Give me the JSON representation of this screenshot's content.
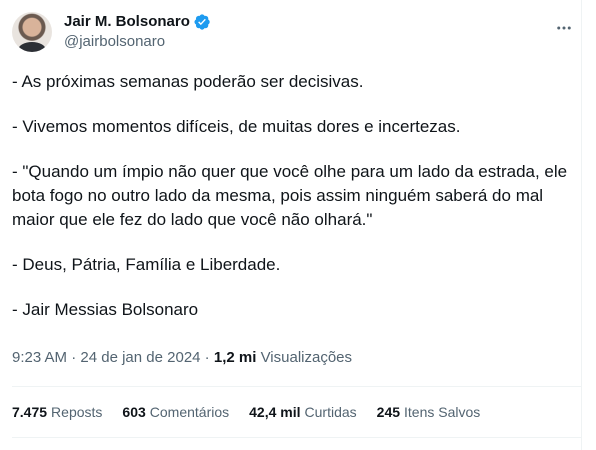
{
  "author": {
    "display_name": "Jair M. Bolsonaro",
    "handle": "@jairbolsonaro",
    "verified": true,
    "avatar_icon": "profile-photo"
  },
  "more_icon": "ellipsis-icon",
  "tweet": {
    "paragraphs": [
      "- As próximas semanas poderão ser decisivas.",
      "- Vivemos momentos difíceis, de muitas dores e incertezas.",
      "- \"Quando um ímpio não quer que você olhe para um lado da estrada, ele bota fogo no outro lado da mesma, pois assim ninguém saberá do mal maior que ele fez do lado que você não olhará.\"",
      "- Deus, Pátria, Família e Liberdade.",
      "- Jair Messias Bolsonaro"
    ]
  },
  "meta": {
    "time": "9:23 AM",
    "separator": " · ",
    "date": "24 de jan de 2024",
    "views_count": "1,2 mi",
    "views_label": "Visualizações"
  },
  "stats": {
    "reposts_count": "7.475",
    "reposts_label": "Reposts",
    "comments_count": "603",
    "comments_label": "Comentários",
    "likes_count": "42,4 mil",
    "likes_label": "Curtidas",
    "saves_count": "245",
    "saves_label": "Itens Salvos"
  },
  "colors": {
    "text_primary": "#0f1419",
    "text_secondary": "#536471",
    "verified_blue": "#1d9bf0",
    "divider": "#eff3f4"
  }
}
